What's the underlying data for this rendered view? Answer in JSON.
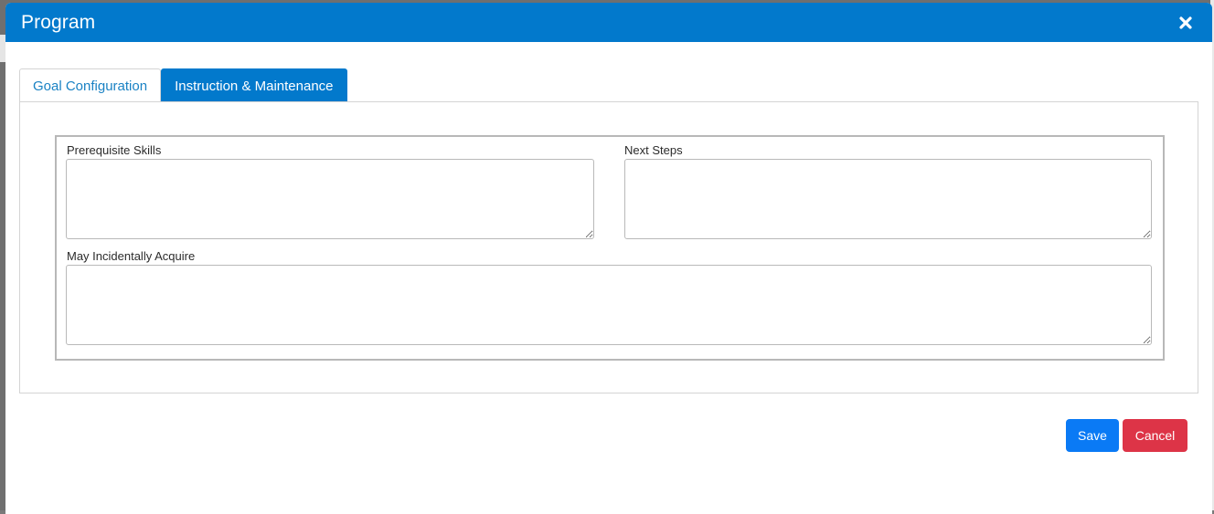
{
  "modal": {
    "title": "Program",
    "close_icon": "close-icon"
  },
  "tabs": [
    {
      "label": "Goal Configuration",
      "active": false
    },
    {
      "label": "Instruction & Maintenance",
      "active": true
    }
  ],
  "form": {
    "prerequisite_skills": {
      "label": "Prerequisite Skills",
      "value": ""
    },
    "next_steps": {
      "label": "Next Steps",
      "value": ""
    },
    "may_incidentally_acquire": {
      "label": "May Incidentally Acquire",
      "value": ""
    }
  },
  "footer": {
    "save_label": "Save",
    "cancel_label": "Cancel"
  },
  "colors": {
    "header": "#0279cc",
    "save": "#0a7af5",
    "cancel": "#dd3447"
  }
}
